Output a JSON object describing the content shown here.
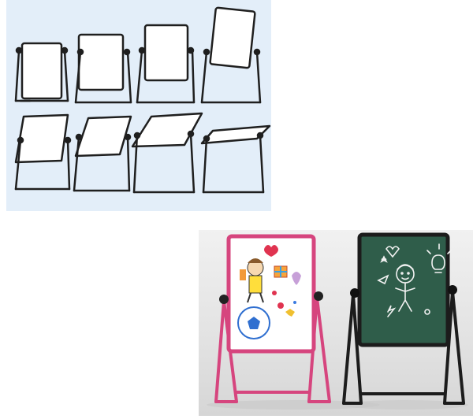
{
  "image": {
    "description_items": [
      {
        "id": "angle-1",
        "tilt": 0
      },
      {
        "id": "angle-2",
        "tilt": 10
      },
      {
        "id": "angle-3",
        "tilt": 20
      },
      {
        "id": "angle-4",
        "tilt": 30
      },
      {
        "id": "angle-5",
        "tilt": 45
      },
      {
        "id": "angle-6",
        "tilt": 60
      },
      {
        "id": "angle-7",
        "tilt": 75
      },
      {
        "id": "angle-8",
        "tilt": 90
      }
    ],
    "colors": {
      "panel_bg": "#e3eef9",
      "frame_dark": "#222222",
      "frame_pink": "#d6457e",
      "chalkboard": "#2f5d4a",
      "whiteboard": "#ffffff"
    }
  }
}
